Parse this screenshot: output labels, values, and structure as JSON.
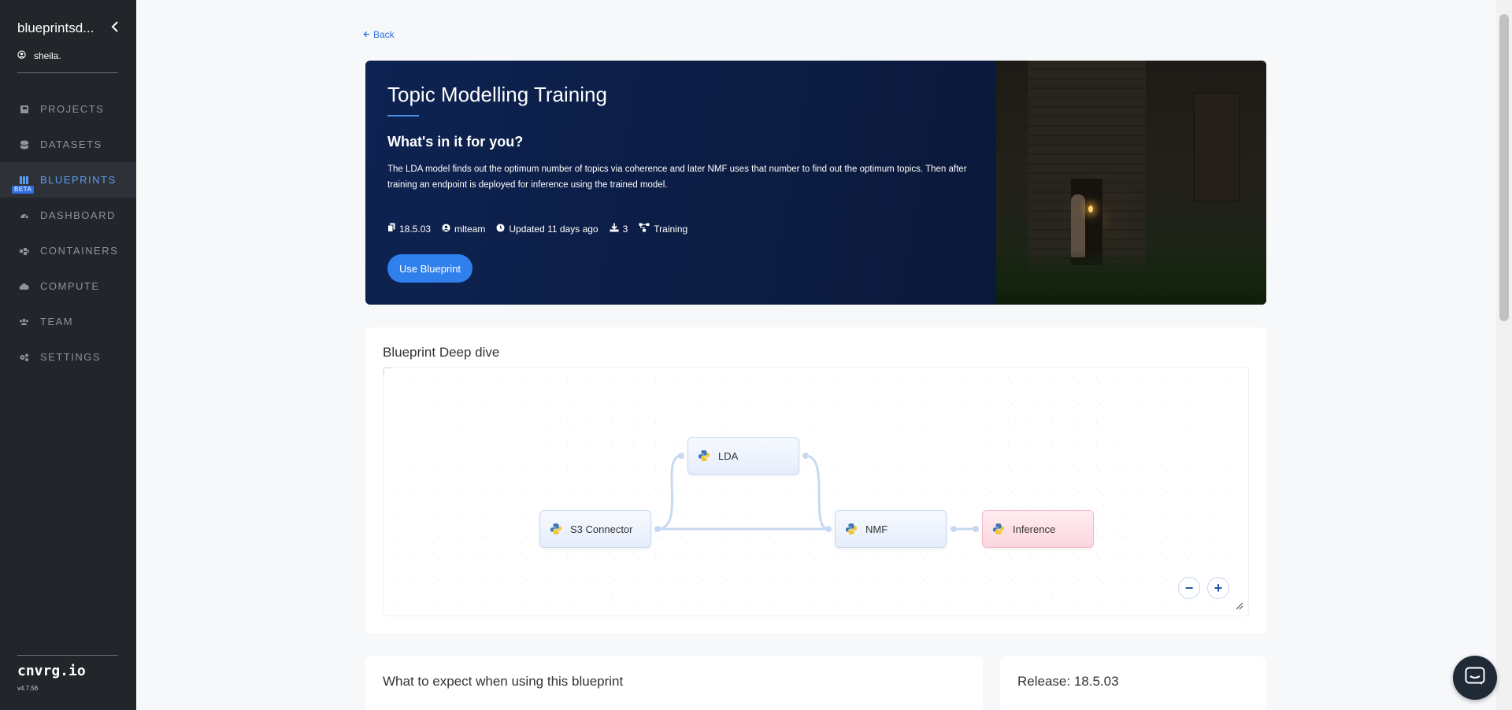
{
  "sidebar": {
    "workspace": "blueprintsd...",
    "user": "sheila.",
    "items": [
      {
        "label": "PROJECTS",
        "icon": "book-icon"
      },
      {
        "label": "DATASETS",
        "icon": "database-icon"
      },
      {
        "label": "BLUEPRINTS",
        "icon": "blueprints-icon",
        "badge": "BETA",
        "active": true
      },
      {
        "label": "DASHBOARD",
        "icon": "gauge-icon"
      },
      {
        "label": "CONTAINERS",
        "icon": "containers-icon"
      },
      {
        "label": "COMPUTE",
        "icon": "cloud-icon"
      },
      {
        "label": "TEAM",
        "icon": "team-icon"
      },
      {
        "label": "SETTINGS",
        "icon": "gears-icon"
      }
    ],
    "brand": "cnvrg.io",
    "version": "v4.7.56"
  },
  "back_label": "Back",
  "hero": {
    "title": "Topic Modelling Training",
    "subtitle": "What's in it for you?",
    "description": "The LDA model finds out the optimum number of topics via coherence and later NMF uses that number to find out the optimum topics. Then after training an endpoint is deployed for inference using the trained model.",
    "meta": {
      "version": "18.5.03",
      "author": "mlteam",
      "updated": "Updated 11 days ago",
      "downloads": "3",
      "type": "Training"
    },
    "use_button": "Use Blueprint"
  },
  "deep_dive": {
    "title": "Blueprint Deep dive",
    "nodes": {
      "lda": "LDA",
      "s3": "S3 Connector",
      "nmf": "NMF",
      "inference": "Inference"
    },
    "zoom_out": "−",
    "zoom_in": "+"
  },
  "expect": {
    "title": "What to expect when using this blueprint"
  },
  "release": {
    "title": "Release: 18.5.03"
  },
  "colors": {
    "accent": "#2f80ed",
    "sidebar_bg": "#22252a",
    "hero_bg": "#0b1a3d"
  }
}
